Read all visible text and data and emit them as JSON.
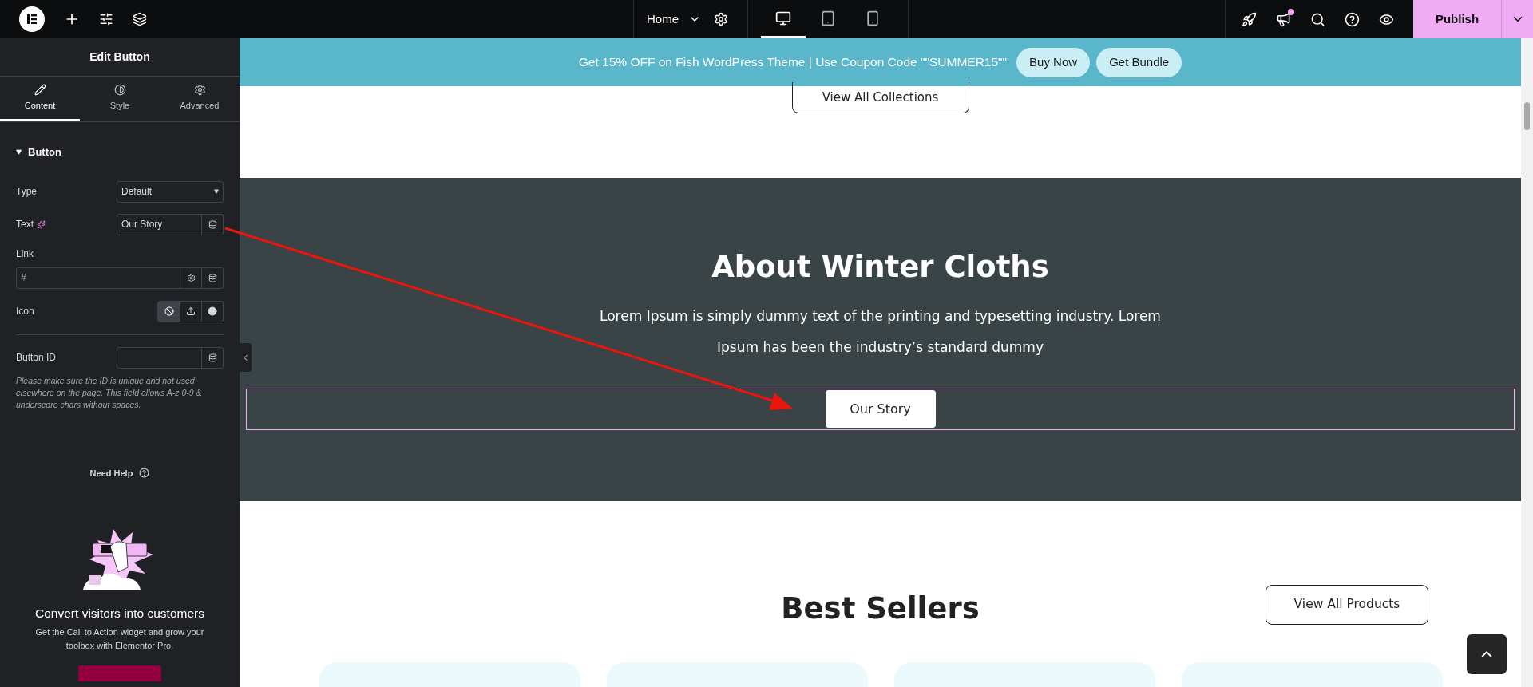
{
  "topbar": {
    "page": "Home",
    "devices": [
      {
        "kind": "desktop",
        "selected": true
      },
      {
        "kind": "tablet",
        "selected": false
      },
      {
        "kind": "mobile",
        "selected": false
      }
    ],
    "notification": true,
    "publish": "Publish"
  },
  "sidebar": {
    "title": "Edit Button",
    "tabs": [
      {
        "kind": "pencil",
        "label": "Content",
        "selected": true
      },
      {
        "kind": "contrast",
        "label": "Style",
        "selected": false
      },
      {
        "kind": "gear",
        "label": "Advanced",
        "selected": false
      }
    ],
    "section": {
      "title": "Button",
      "expanded": true
    },
    "type": {
      "label": "Type",
      "value": "Default"
    },
    "text": {
      "label": "Text",
      "value": "Our Story"
    },
    "link": {
      "label": "Link",
      "value": "#"
    },
    "icon": {
      "label": "Icon",
      "options": [
        {
          "kind": "none",
          "selected": true
        },
        {
          "kind": "upload",
          "selected": false
        },
        {
          "kind": "circle",
          "selected": false
        }
      ]
    },
    "button_id": {
      "label": "Button ID"
    },
    "help": "Please make sure the ID is unique and not used elsewhere on the page. This field allows A-z  0-9 & underscore chars without spaces.",
    "need_help": "Need Help",
    "promo": {
      "title": "Convert visitors into customers",
      "description": "Get the Call to Action widget and grow your toolbox with Elementor Pro."
    }
  },
  "canvas": {
    "banner": {
      "text": "Get 15% OFF on Fish WordPress Theme | Use Coupon Code \"\"SUMMER15\"\"",
      "buttons": [
        "Buy Now",
        "Get Bundle"
      ]
    },
    "view_all_collections": "View All Collections",
    "about": {
      "title": "About Winter Cloths",
      "text": "Lorem Ipsum is simply dummy text of the printing and typesetting industry. Lorem Ipsum has been the industry’s standard dummy",
      "button": "Our Story",
      "selected": true
    },
    "best_sellers": {
      "title": "Best Sellers",
      "button": "View All Products",
      "cards": [
        {
          "kind": "card"
        },
        {
          "kind": "card"
        },
        {
          "kind": "card"
        },
        {
          "kind": "card"
        }
      ]
    }
  }
}
